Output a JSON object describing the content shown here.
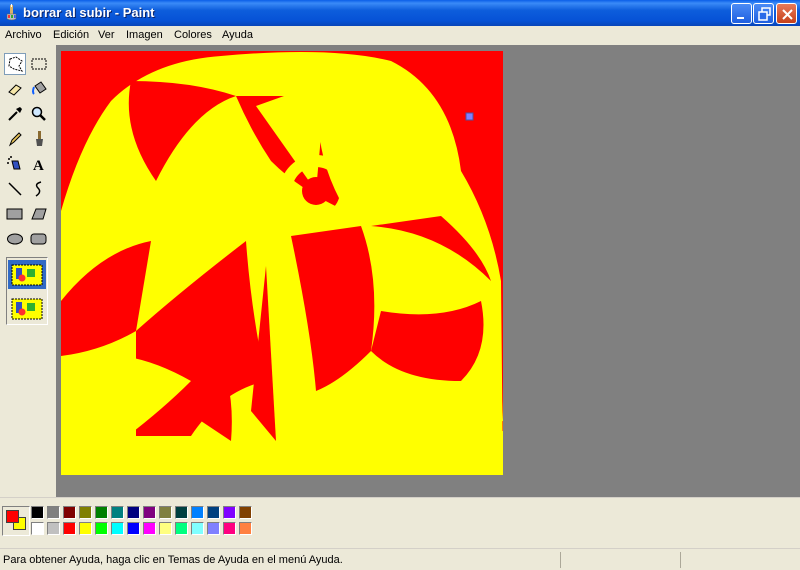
{
  "window": {
    "title": "borrar al subir - Paint"
  },
  "menu": [
    "Archivo",
    "Edición",
    "Ver",
    "Imagen",
    "Colores",
    "Ayuda"
  ],
  "tools": [
    {
      "name": "free-select-tool-icon",
      "selected": true
    },
    {
      "name": "rect-select-tool-icon",
      "selected": false
    },
    {
      "name": "eraser-tool-icon",
      "selected": false
    },
    {
      "name": "fill-tool-icon",
      "selected": false
    },
    {
      "name": "color-picker-tool-icon",
      "selected": false
    },
    {
      "name": "magnifier-tool-icon",
      "selected": false
    },
    {
      "name": "pencil-tool-icon",
      "selected": false
    },
    {
      "name": "brush-tool-icon",
      "selected": false
    },
    {
      "name": "airbrush-tool-icon",
      "selected": false
    },
    {
      "name": "text-tool-icon",
      "selected": false
    },
    {
      "name": "line-tool-icon",
      "selected": false
    },
    {
      "name": "curve-tool-icon",
      "selected": false
    },
    {
      "name": "rectangle-tool-icon",
      "selected": false
    },
    {
      "name": "polygon-tool-icon",
      "selected": false
    },
    {
      "name": "ellipse-tool-icon",
      "selected": false
    },
    {
      "name": "rounded-rect-tool-icon",
      "selected": false
    }
  ],
  "colors": {
    "foreground": "#ff0000",
    "background": "#ffff00",
    "palette_top": [
      "#000000",
      "#808080",
      "#800000",
      "#808000",
      "#008000",
      "#008080",
      "#000080",
      "#800080",
      "#808040",
      "#004040",
      "#0080ff",
      "#004080",
      "#8000ff",
      "#804000"
    ],
    "palette_bottom": [
      "#ffffff",
      "#c0c0c0",
      "#ff0000",
      "#ffff00",
      "#00ff00",
      "#00ffff",
      "#0000ff",
      "#ff00ff",
      "#ffff80",
      "#00ff80",
      "#80ffff",
      "#8080ff",
      "#ff0080",
      "#ff8040"
    ]
  },
  "status": {
    "help_text": "Para obtener Ayuda, haga clic en Temas de Ayuda en el menú Ayuda."
  }
}
